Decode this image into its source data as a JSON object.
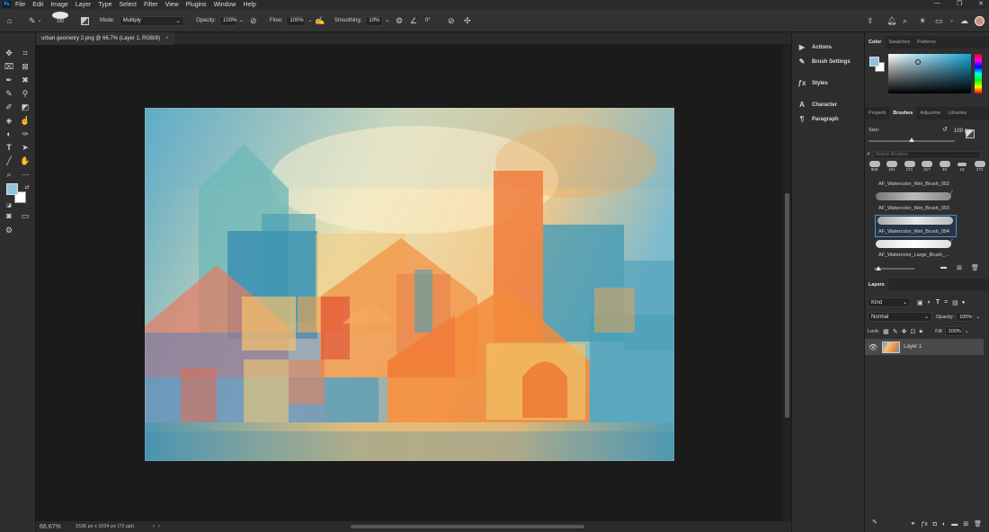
{
  "app": {
    "logo": "Ps"
  },
  "menu": [
    "File",
    "Edit",
    "Image",
    "Layer",
    "Type",
    "Select",
    "Filter",
    "View",
    "Plugins",
    "Window",
    "Help"
  ],
  "window_controls": {
    "minimize": "—",
    "maximize": "❐",
    "close": "✕"
  },
  "options": {
    "brush_size": "100",
    "mode_label": "Mode:",
    "mode_value": "Multiply",
    "opacity_label": "Opacity:",
    "opacity_value": "100%",
    "flow_label": "Flow:",
    "flow_value": "100%",
    "smoothing_label": "Smoothing:",
    "smoothing_value": "10%",
    "angle_value": "0°"
  },
  "document": {
    "tab_title": "urban geometry 2.png @ 66.7% (Layer 1, RGB/8)",
    "close": "×",
    "zoom": "66.67%",
    "info": "1536 px x 1024 px (72 ppi)"
  },
  "mid_panel": {
    "actions": "Actions",
    "brush_settings": "Brush Settings",
    "styles": "Styles",
    "character": "Character",
    "paragraph": "Paragraph"
  },
  "color_tabs": [
    "Color",
    "Swatches",
    "Patterns"
  ],
  "color": {
    "foreground": "#8ec5de",
    "background": "#ffffff"
  },
  "brush_tabs": [
    "Properti",
    "Brushes",
    "Adjustme",
    "Libraries"
  ],
  "brushes": {
    "size_label": "Size:",
    "size_value": "100 px",
    "search_placeholder": "Search Brushes",
    "presets": [
      "958",
      "401",
      "171",
      "317",
      "48",
      "10",
      "173"
    ],
    "list": [
      "AF_Watercolor_Wet_Brush_002",
      "AF_Watercolor_Wet_Brush_003",
      "AF_Watercolor_Wet_Brush_004",
      "AF_Watercolor_Large_Brush_..."
    ],
    "selected_index": 2
  },
  "layers": {
    "tab": "Layers",
    "kind": "Kind",
    "blend": "Normal",
    "opacity_label": "Opacity:",
    "opacity_value": "100%",
    "lock_label": "Lock:",
    "fill_label": "Fill:",
    "fill_value": "100%",
    "items": [
      {
        "name": "Layer 1",
        "visible": true
      }
    ]
  }
}
